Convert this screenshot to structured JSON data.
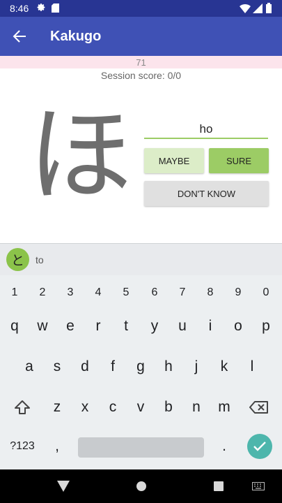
{
  "status_bar": {
    "time": "8:46",
    "icons": [
      "gear-icon",
      "sd-card-icon",
      "wifi-icon",
      "signal-icon",
      "battery-icon"
    ]
  },
  "app_bar": {
    "title": "Kakugo",
    "back_icon": "arrow-back-icon"
  },
  "quiz": {
    "progress_count": "71",
    "session_score": "Session score: 0/0",
    "kana": "ほ",
    "answer_value": "ho",
    "buttons": {
      "maybe": "MAYBE",
      "sure": "SURE",
      "dont_know": "DON'T KNOW"
    }
  },
  "keyboard": {
    "suggestion": {
      "kana": "と",
      "text": "to"
    },
    "rows": [
      [
        "1",
        "2",
        "3",
        "4",
        "5",
        "6",
        "7",
        "8",
        "9",
        "0"
      ],
      [
        "q",
        "w",
        "e",
        "r",
        "t",
        "y",
        "u",
        "i",
        "o",
        "p"
      ],
      [
        "a",
        "s",
        "d",
        "f",
        "g",
        "h",
        "j",
        "k",
        "l"
      ],
      [
        "z",
        "x",
        "c",
        "v",
        "b",
        "n",
        "m"
      ]
    ],
    "symbols_key": "?123",
    "comma_key": ",",
    "period_key": ".",
    "shift_icon": "shift-icon",
    "backspace_icon": "backspace-icon",
    "enter_icon": "check-icon"
  },
  "nav_bar": {
    "icons": [
      "nav-back-icon",
      "nav-home-icon",
      "nav-recents-icon",
      "keyboard-switch-icon"
    ]
  },
  "colors": {
    "status_bar": "#283593",
    "app_bar": "#3f51b5",
    "progress_strip": "#fce4ec",
    "sure_button": "#9ccc65",
    "maybe_button": "#dcedc8",
    "dont_know_button": "#e0e0e0",
    "enter_key": "#4db6ac",
    "suggestion_chip": "#8bc34a"
  }
}
